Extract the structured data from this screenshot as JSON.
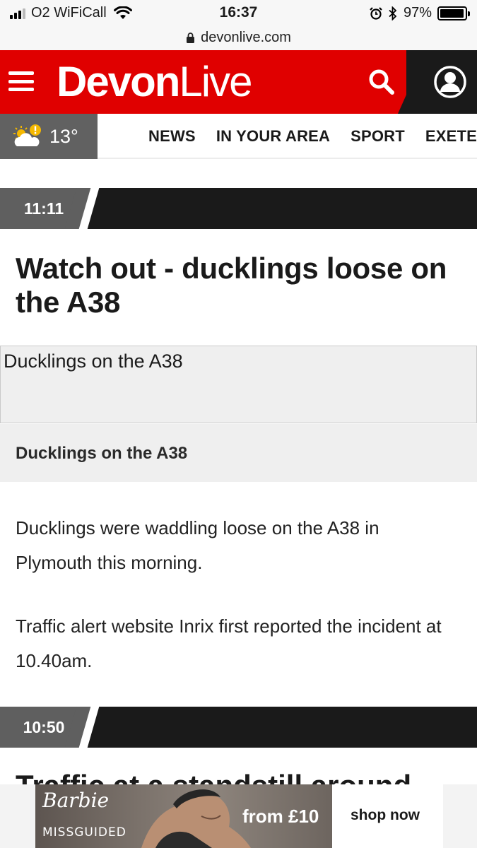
{
  "status_bar": {
    "carrier": "O2 WiFiCall",
    "time": "16:37",
    "battery": "97%",
    "battery_level": 0.97
  },
  "url_bar": {
    "domain": "devonlive.com"
  },
  "header": {
    "logo_bold": "Devon",
    "logo_light": "Live",
    "brand_red": "#e00000",
    "brand_dark": "#1a1a1a"
  },
  "weather": {
    "temperature": "13°",
    "icon": "sun-cloud-warning-icon"
  },
  "nav": {
    "items": [
      "NEWS",
      "IN YOUR AREA",
      "SPORT",
      "EXETER"
    ]
  },
  "posts": [
    {
      "time": "11:11",
      "headline": "Watch out - ducklings loose on the A38",
      "image_alt": "Ducklings on the A38",
      "caption": "Ducklings on the A38",
      "paragraphs": [
        "Ducklings were waddling loose on the A38 in Plymouth this morning.",
        "Traffic alert website Inrix first reported the incident at 10.40am."
      ]
    },
    {
      "time": "10:50",
      "headline": "Traffic at a standstill around"
    }
  ],
  "ad": {
    "brand_script": "Barbie",
    "brand": "MISSGUIDED",
    "price": "from £10",
    "cta": "shop now"
  }
}
